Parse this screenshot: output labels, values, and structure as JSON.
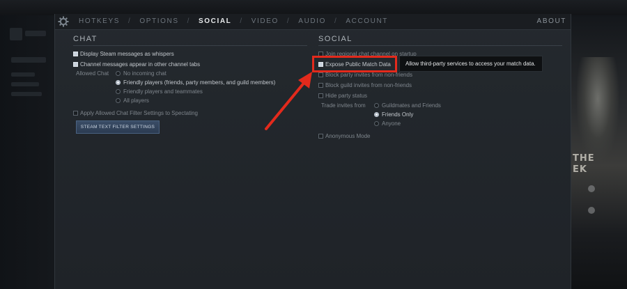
{
  "tabs": [
    {
      "label": "HOTKEYS",
      "active": false
    },
    {
      "label": "OPTIONS",
      "active": false
    },
    {
      "label": "SOCIAL",
      "active": true
    },
    {
      "label": "VIDEO",
      "active": false
    },
    {
      "label": "AUDIO",
      "active": false
    },
    {
      "label": "ACCOUNT",
      "active": false
    }
  ],
  "about_label": "ABOUT",
  "chat": {
    "title": "CHAT",
    "options": [
      {
        "label": "Display Steam messages as whispers",
        "checked": true
      },
      {
        "label": "Channel messages appear in other channel tabs",
        "checked": true
      }
    ],
    "allowed_chat_label": "Allowed Chat",
    "allowed_chat_options": [
      {
        "label": "No incoming chat",
        "selected": false
      },
      {
        "label": "Friendly players (friends, party members, and guild members)",
        "selected": true
      },
      {
        "label": "Friendly players and teammates",
        "selected": false
      },
      {
        "label": "All players",
        "selected": false
      }
    ],
    "apply_filter": {
      "label": "Apply Allowed Chat Filter Settings to Spectating",
      "checked": false
    },
    "filter_button_label": "STEAM TEXT FILTER SETTINGS"
  },
  "social": {
    "title": "SOCIAL",
    "options": [
      {
        "label": "Join regional chat channel on startup",
        "checked": false
      },
      {
        "label": "Expose Public Match Data",
        "checked": true
      },
      {
        "label": "Block party invites from non-friends",
        "checked": false
      },
      {
        "label": "Block guild invites from non-friends",
        "checked": false
      },
      {
        "label": "Hide party status",
        "checked": false
      }
    ],
    "trade_label": "Trade invites from",
    "trade_options": [
      {
        "label": "Guildmates and Friends",
        "selected": false
      },
      {
        "label": "Friends Only",
        "selected": true
      },
      {
        "label": "Anyone",
        "selected": false
      }
    ],
    "anonymous": {
      "label": "Anonymous Mode",
      "checked": false
    }
  },
  "tooltip_text": "Allow third-party services to access your match data.",
  "background": {
    "right_text_1": "THE",
    "right_text_2": "EK"
  },
  "colors": {
    "highlight": "#e32a1c",
    "panel": "#24292e",
    "button": "#34465d"
  }
}
